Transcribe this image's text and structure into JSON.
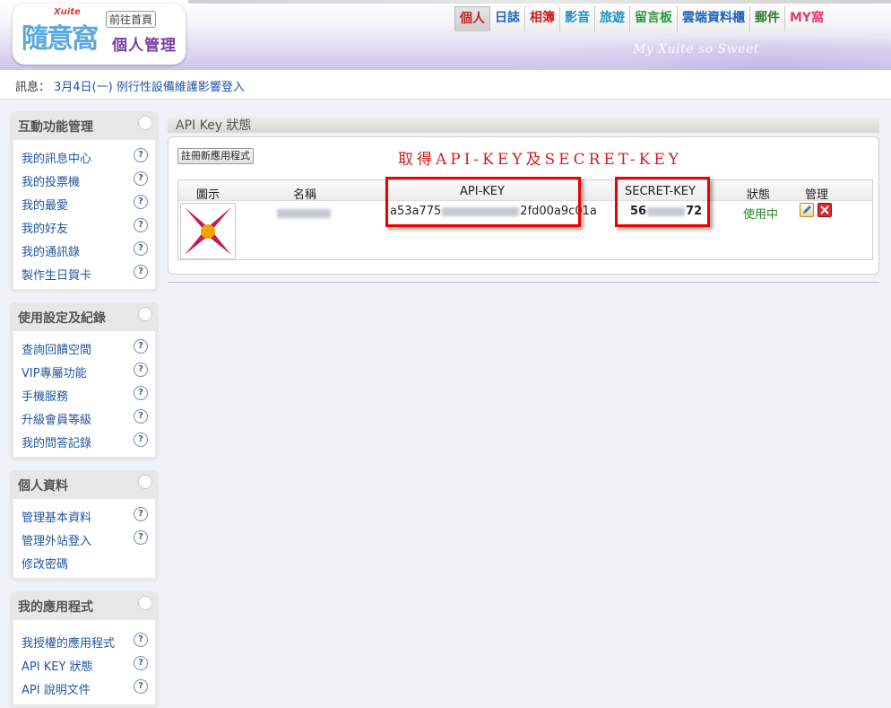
{
  "header": {
    "logo": {
      "brand": "Xuite",
      "title": "隨意窩",
      "home_label": "前往首頁",
      "subtitle": "個人管理"
    },
    "slogan": "My Xuite so Sweet",
    "nav": [
      {
        "label": "個人",
        "color": "#cc2222",
        "active": true
      },
      {
        "label": "日誌",
        "color": "#2266bb"
      },
      {
        "label": "相簿",
        "color": "#cc2222"
      },
      {
        "label": "影音",
        "color": "#1f8fbf"
      },
      {
        "label": "旅遊",
        "color": "#1f8fbf"
      },
      {
        "label": "留言板",
        "color": "#2b9a3a"
      },
      {
        "label": "雲端資料櫃",
        "color": "#2266bb"
      },
      {
        "label": "郵件",
        "color": "#2b7a2b"
      },
      {
        "label": "MY窩",
        "color": "#e2397a"
      }
    ]
  },
  "message": {
    "label": "訊息：",
    "text": "3月4日(一) 例行性設備維護影響登入"
  },
  "sidebar": [
    {
      "title": "互動功能管理",
      "items": [
        "我的訊息中心",
        "我的投票機",
        "我的最愛",
        "我的好友",
        "我的通訊錄",
        "製作生日賀卡"
      ]
    },
    {
      "title": "使用設定及紀錄",
      "items": [
        "查詢回饋空間",
        "VIP專屬功能",
        "手機服務",
        "升級會員等級",
        "我的問答記錄"
      ]
    },
    {
      "title": "個人資料",
      "items": [
        "管理基本資料",
        "管理外站登入",
        "修改密碼"
      ]
    },
    {
      "title": "我的應用程式",
      "items": [
        "我授權的應用程式",
        "API KEY 狀態",
        "API 說明文件"
      ]
    }
  ],
  "content": {
    "title": "API Key 狀態",
    "register_button": "註冊新應用程式",
    "annotation": "取得API-KEY及SECRET-KEY",
    "table": {
      "headers": [
        "圖示",
        "名稱",
        "API-KEY",
        "SECRET-KEY",
        "狀態",
        "管理"
      ],
      "row": {
        "api_key_start": "a53a775",
        "api_key_end": "2fd00a9c01a",
        "secret_start": "56",
        "secret_end": "72",
        "status": "使用中"
      }
    }
  }
}
